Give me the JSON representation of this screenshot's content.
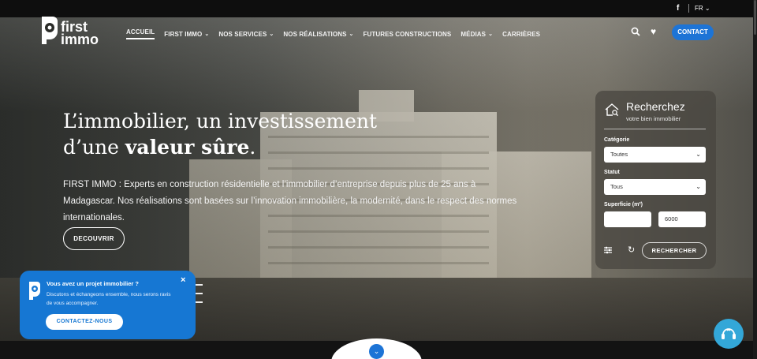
{
  "topbar": {
    "facebook_icon": "facebook-icon",
    "language": "FR",
    "language_caret": "⌄"
  },
  "logo": {
    "line1": "first",
    "line2": "immo"
  },
  "nav": {
    "items": [
      {
        "label": "ACCUEIL",
        "active": true,
        "caret": ""
      },
      {
        "label": "FIRST IMMO",
        "caret": "⌄"
      },
      {
        "label": "NOS SERVICES",
        "caret": "⌄"
      },
      {
        "label": "NOS RÉALISATIONS",
        "caret": "⌄"
      },
      {
        "label": "FUTURES CONSTRUCTIONS",
        "caret": ""
      },
      {
        "label": "MÉDIAS",
        "caret": "⌄"
      },
      {
        "label": "CARRIÈRES",
        "caret": ""
      }
    ],
    "contact_label": "CONTACT"
  },
  "hero": {
    "headline_line1": "L’immobilier, un investissement",
    "headline_line2_prefix": "d’une ",
    "headline_line2_bold": "valeur sûre",
    "headline_line2_suffix": ".",
    "description": "FIRST IMMO : Experts en construction résidentielle et l’immobilier d’entreprise depuis plus de 25 ans à Madagascar. Nos réalisations sont basées sur l’innovation immobilière, la modernité, dans le respect des normes internationales.",
    "cta_label": "DECOUVRIR"
  },
  "search": {
    "title": "Recherchez",
    "subtitle": "votre bien immobilier",
    "category_label": "Catégorie",
    "category_value": "Toutes",
    "status_label": "Statut",
    "status_value": "Tous",
    "area_label": "Superficie (m²)",
    "area_min": "",
    "area_max": "6000",
    "submit_label": "RECHERCHER",
    "select_caret": "⌄",
    "reset_glyph": "↻"
  },
  "promo": {
    "title": "Vous avez un projet immobilier ?",
    "text": "Discutons et échangeons ensemble, nous serons ravis de vous accompagner.",
    "cta_label": "CONTACTEZ-NOUS",
    "close_glyph": "×"
  },
  "scroll_down_glyph": "⌄",
  "colors": {
    "accent": "#1d74d6",
    "promo": "#1677d3",
    "chat": "#33a7d8"
  }
}
